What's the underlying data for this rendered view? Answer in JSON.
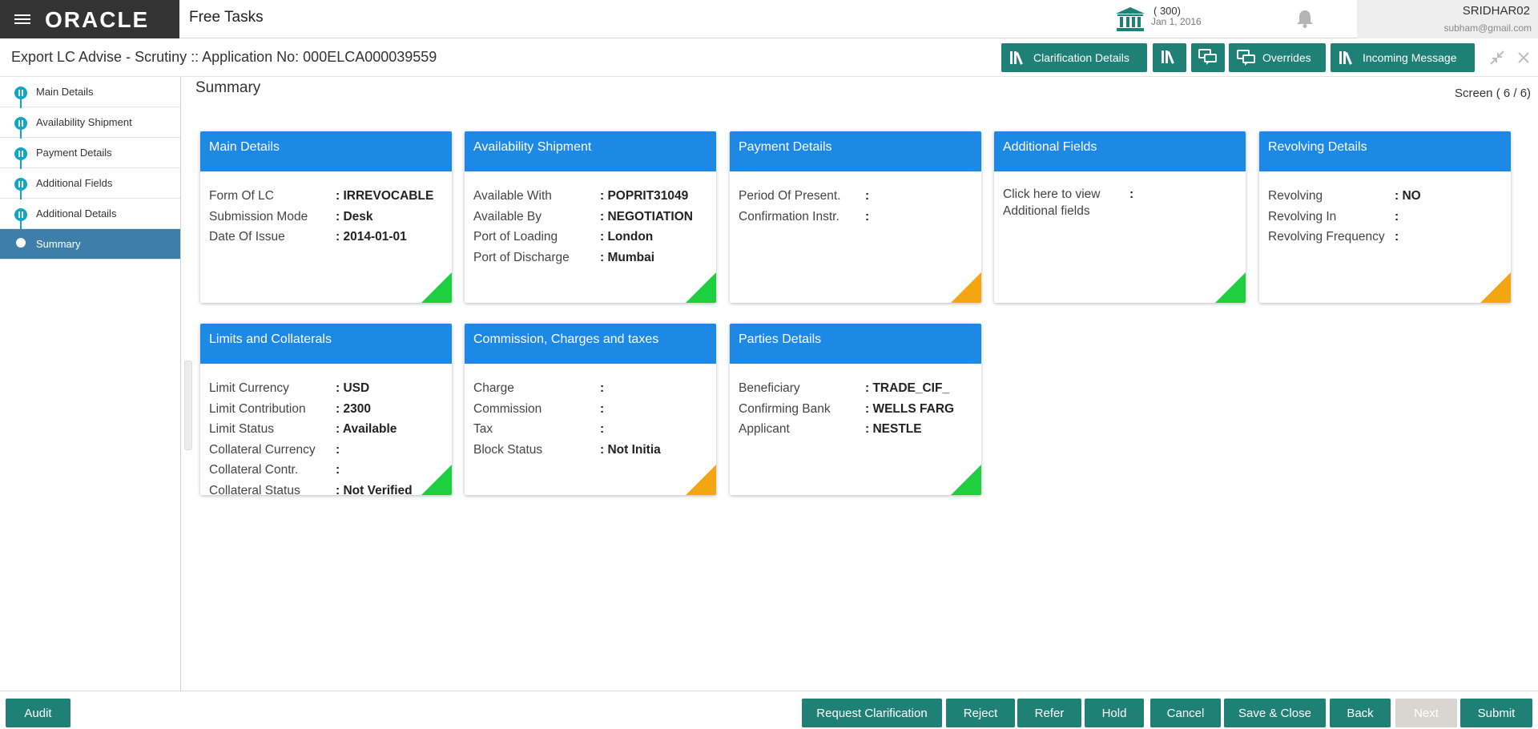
{
  "topbar": {
    "logo": "ORACLE",
    "app_title": "Free Tasks",
    "branch_code": "( 300)",
    "branch_date": "Jan 1, 2016",
    "user_name": "SRIDHAR02",
    "user_email": "subham@gmail.com"
  },
  "header": {
    "page_title": "Export LC Advise - Scrutiny :: Application No: 000ELCA000039559",
    "buttons": {
      "clarification": "Clarification Details",
      "overrides": "Overrides",
      "incoming": "Incoming Message"
    }
  },
  "sidebar": {
    "items": [
      {
        "label": "Main Details"
      },
      {
        "label": "Availability Shipment"
      },
      {
        "label": "Payment Details"
      },
      {
        "label": "Additional Fields"
      },
      {
        "label": "Additional Details"
      },
      {
        "label": "Summary"
      }
    ]
  },
  "main": {
    "title": "Summary",
    "screen": "Screen ( 6 / 6)",
    "cards": [
      {
        "title": "Main Details",
        "rows": [
          {
            "k": "Form Of LC",
            "v": ": IRREVOCABLE"
          },
          {
            "k": "Submission Mode",
            "v": ": Desk"
          },
          {
            "k": "Date Of Issue",
            "v": ": 2014-01-01"
          }
        ]
      },
      {
        "title": "Availability Shipment",
        "rows": [
          {
            "k": "Available With",
            "v": ": POPRIT31049"
          },
          {
            "k": "Available By",
            "v": ": NEGOTIATION"
          },
          {
            "k": "Port of Loading",
            "v": ": London"
          },
          {
            "k": "Port of Discharge",
            "v": ": Mumbai"
          }
        ]
      },
      {
        "title": "Payment Details",
        "rows": [
          {
            "k": "Period Of Present.",
            "v": ":"
          },
          {
            "k": "Confirmation Instr.",
            "v": ":"
          }
        ]
      },
      {
        "title": "Additional Fields",
        "rows": [
          {
            "k": "Click here to view",
            "k2": "Additional fields",
            "v": ":"
          }
        ]
      },
      {
        "title": "Revolving Details",
        "rows": [
          {
            "k": "Revolving",
            "v": ": NO"
          },
          {
            "k": "Revolving In",
            "v": ":"
          },
          {
            "k": "Revolving Frequency",
            "v": ":"
          }
        ]
      },
      {
        "title": "Limits and Collaterals",
        "rows": [
          {
            "k": "Limit Currency",
            "v": ": USD"
          },
          {
            "k": "Limit Contribution",
            "v": ": 2300"
          },
          {
            "k": "Limit Status",
            "v": ": Available"
          },
          {
            "k": "Collateral Currency",
            "v": ":"
          },
          {
            "k": "Collateral Contr.",
            "v": ":"
          },
          {
            "k": "Collateral Status",
            "v": ": Not Verified"
          }
        ]
      },
      {
        "title": "Commission, Charges and taxes",
        "rows": [
          {
            "k": "Charge",
            "v": ":"
          },
          {
            "k": "Commission",
            "v": ":"
          },
          {
            "k": "Tax",
            "v": ":"
          },
          {
            "k": "Block Status",
            "v": ": Not Initia"
          }
        ]
      },
      {
        "title": "Parties Details",
        "rows": [
          {
            "k": "Beneficiary",
            "v": ": TRADE_CIF_"
          },
          {
            "k": "Confirming Bank",
            "v": ": WELLS FARG"
          },
          {
            "k": "Applicant",
            "v": ": NESTLE"
          }
        ]
      }
    ]
  },
  "footer": {
    "audit": "Audit",
    "request_clarification": "Request Clarification",
    "reject": "Reject",
    "refer": "Refer",
    "hold": "Hold",
    "cancel": "Cancel",
    "save_close": "Save & Close",
    "back": "Back",
    "next": "Next",
    "submit": "Submit"
  },
  "colors": {
    "header_bg": "#333333",
    "action_teal": "#1f8076",
    "card_header": "#1e88e5",
    "sidebar_active": "#3d7fa8",
    "status_green": "#1ed040",
    "status_orange": "#f3a512"
  },
  "icons": [
    "menu-icon",
    "bank-icon",
    "bell-icon",
    "library-icon",
    "chat-icon",
    "minimize-icon",
    "close-icon"
  ]
}
